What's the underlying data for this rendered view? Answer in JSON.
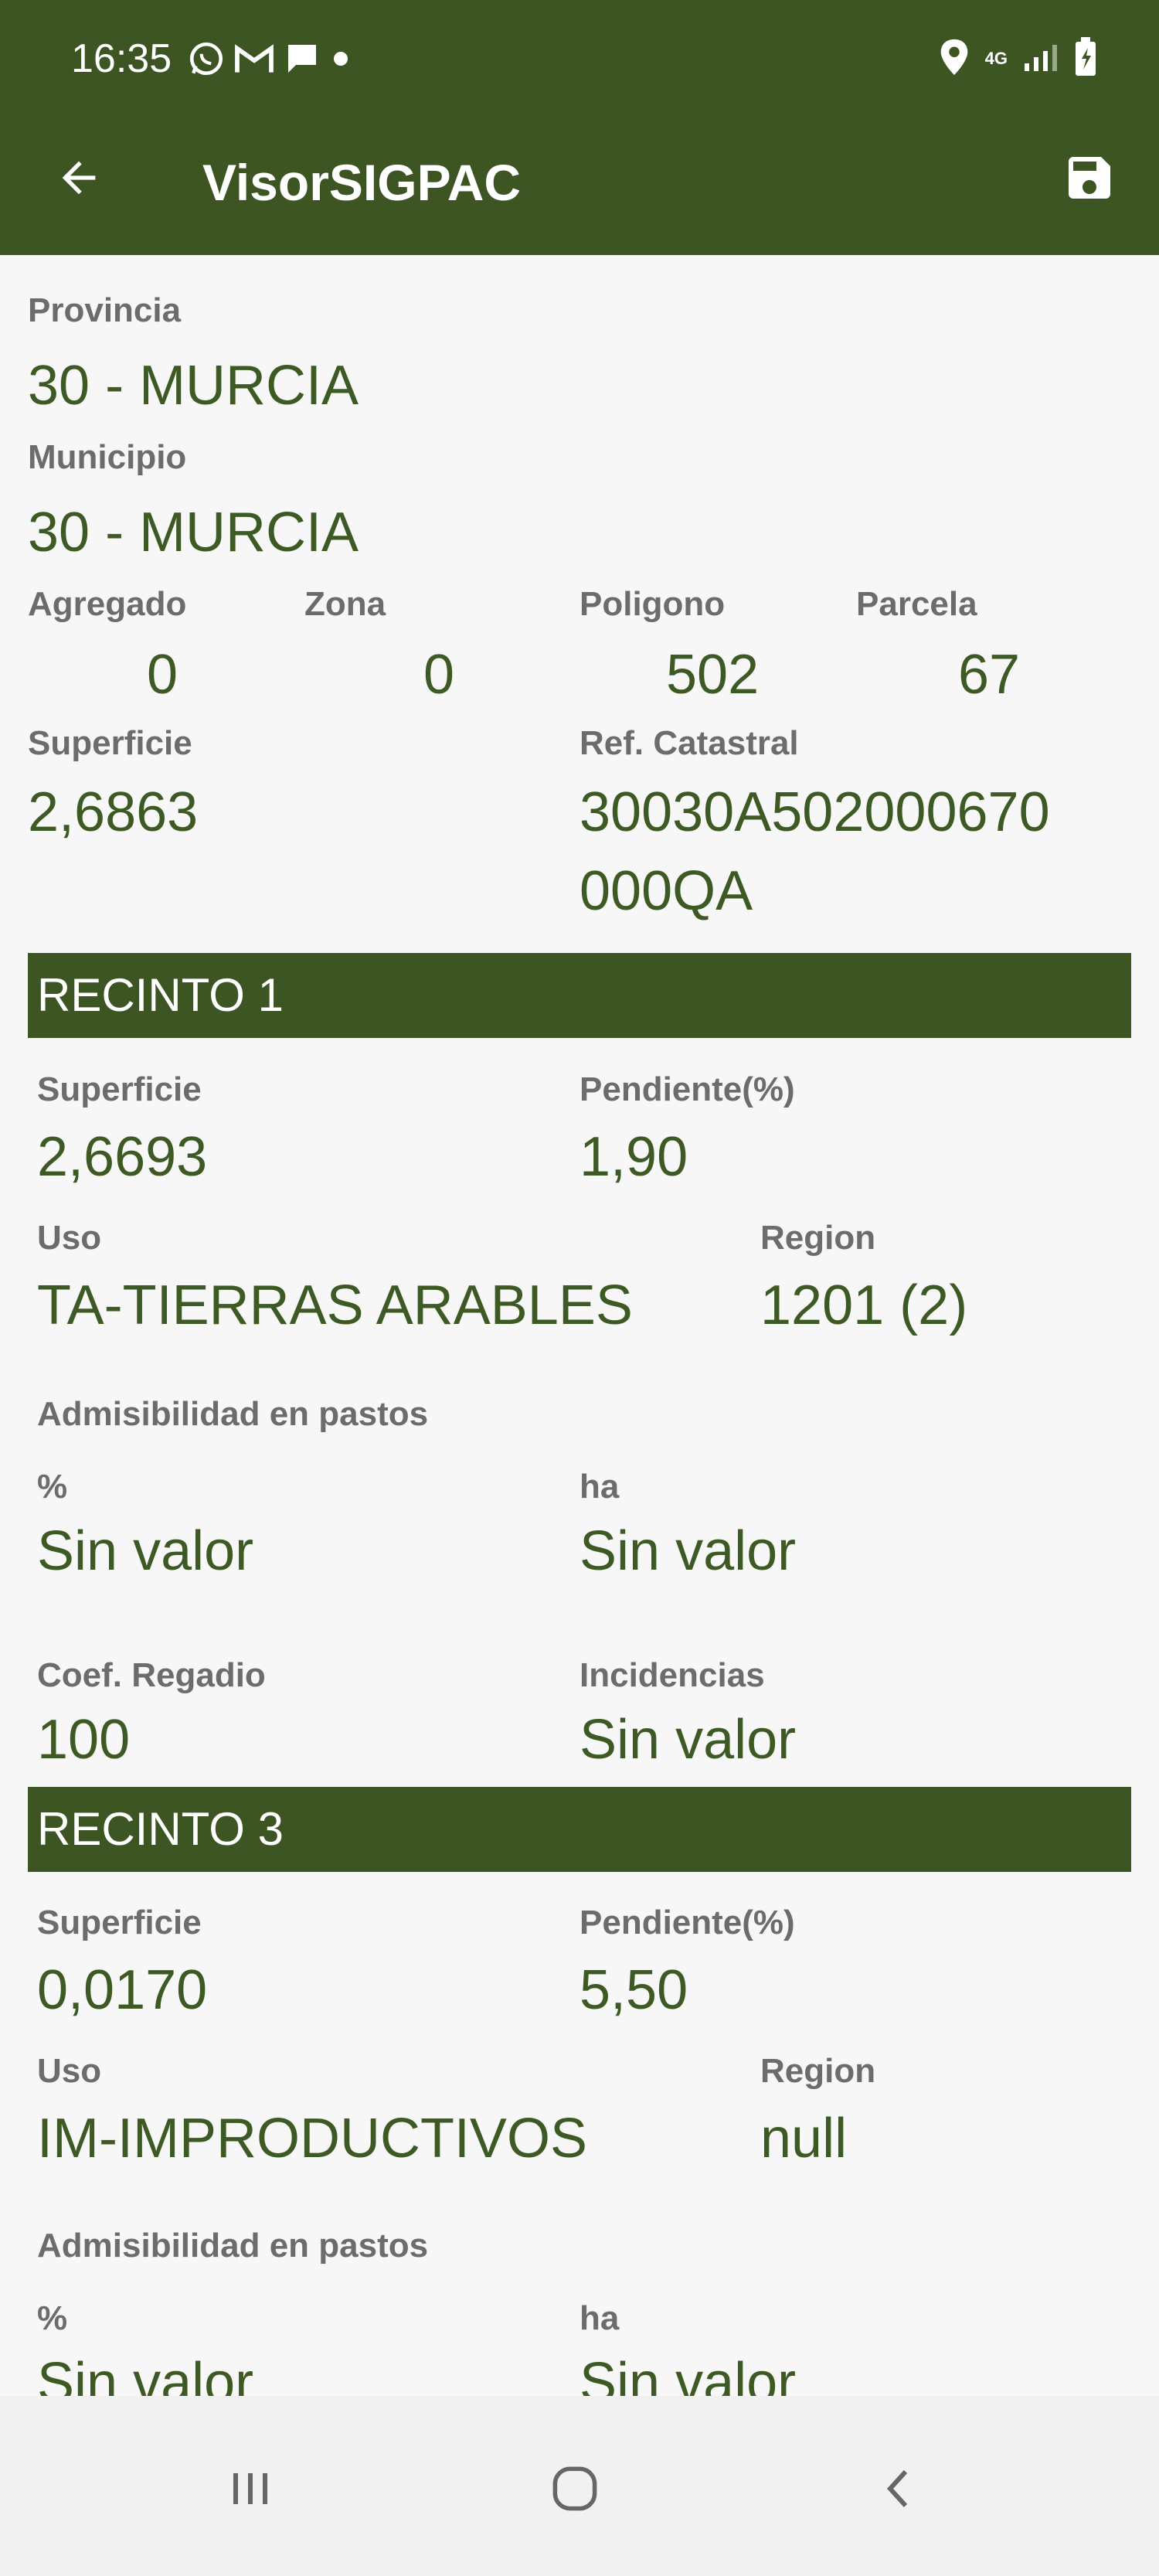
{
  "status_bar": {
    "time": "16:35",
    "icons": [
      "whatsapp-icon",
      "gmail-icon",
      "message-icon",
      "dot-icon",
      "location-icon",
      "4g-icon",
      "signal-icon",
      "battery-icon"
    ],
    "network": "4G"
  },
  "toolbar": {
    "title": "VisorSIGPAC",
    "back_icon": "arrow-left-icon",
    "save_icon": "save-icon"
  },
  "colors": {
    "primary": "#3c5522",
    "value_text": "#3d5a24",
    "label_text": "#6c6c6c",
    "background": "#f7f7f7"
  },
  "parcel": {
    "provincia_label": "Provincia",
    "provincia_value": "30 - MURCIA",
    "municipio_label": "Municipio",
    "municipio_value": "30 - MURCIA",
    "agregado_label": "Agregado",
    "agregado_value": "0",
    "zona_label": "Zona",
    "zona_value": "0",
    "poligono_label": "Poligono",
    "poligono_value": "502",
    "parcela_label": "Parcela",
    "parcela_value": "67",
    "superficie_label": "Superficie",
    "superficie_value": "2,6863",
    "ref_label": "Ref. Catastral",
    "ref_value_line1": "30030A502000670",
    "ref_value_line2": "000QA"
  },
  "recinto1": {
    "header": "RECINTO 1",
    "superficie_label": "Superficie",
    "superficie_value": "2,6693",
    "pendiente_label": "Pendiente(%)",
    "pendiente_value": "1,90",
    "uso_label": "Uso",
    "uso_value": "TA-TIERRAS ARABLES",
    "region_label": "Region",
    "region_value": "1201 (2)",
    "admisibilidad_label": "Admisibilidad en pastos",
    "pct_label": "%",
    "pct_value": "Sin valor",
    "ha_label": "ha",
    "ha_value": "Sin valor",
    "coef_label": "Coef. Regadio",
    "coef_value": "100",
    "incidencias_label": "Incidencias",
    "incidencias_value": "Sin valor"
  },
  "recinto3": {
    "header": "RECINTO 3",
    "superficie_label": "Superficie",
    "superficie_value": "0,0170",
    "pendiente_label": "Pendiente(%)",
    "pendiente_value": "5,50",
    "uso_label": "Uso",
    "uso_value": "IM-IMPRODUCTIVOS",
    "region_label": "Region",
    "region_value": "null",
    "admisibilidad_label": "Admisibilidad en pastos",
    "pct_label": "%",
    "pct_value": "Sin valor",
    "ha_label": "ha",
    "ha_value": "Sin valor"
  },
  "nav_bar": {
    "icons": [
      "recent-apps-icon",
      "home-icon",
      "back-icon"
    ]
  }
}
